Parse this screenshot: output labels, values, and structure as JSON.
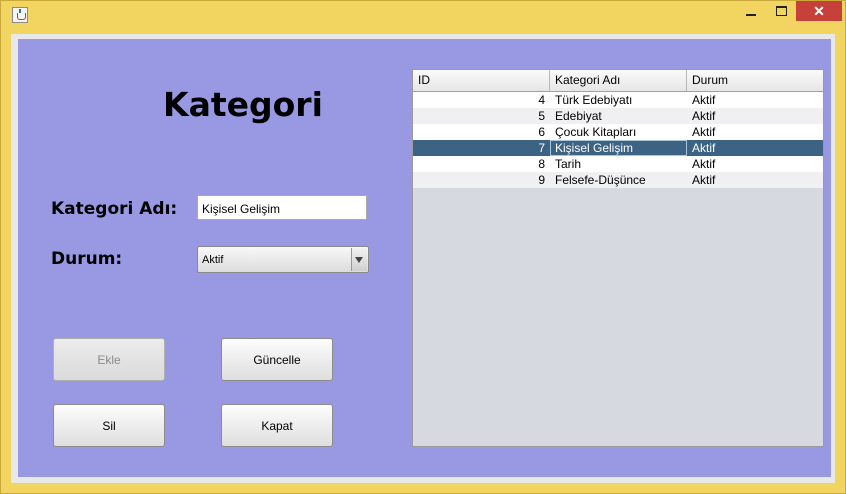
{
  "window": {
    "close_glyph": "✕"
  },
  "form": {
    "title": "Kategori",
    "kategori_adi_label": "Kategori Adı:",
    "kategori_adi_value": "Kişisel Gelişim",
    "durum_label": "Durum:",
    "durum_value": "Aktif"
  },
  "buttons": {
    "ekle": "Ekle",
    "guncelle": "Güncelle",
    "sil": "Sil",
    "kapat": "Kapat"
  },
  "table": {
    "columns": [
      "ID",
      "Kategori Adı",
      "Durum"
    ],
    "rows": [
      {
        "id": "4",
        "ad": "Türk Edebiyatı",
        "durum": "Aktif"
      },
      {
        "id": "5",
        "ad": "Edebiyat",
        "durum": "Aktif"
      },
      {
        "id": "6",
        "ad": "Çocuk Kitapları",
        "durum": "Aktif"
      },
      {
        "id": "7",
        "ad": "Kişisel Gelişim",
        "durum": "Aktif"
      },
      {
        "id": "8",
        "ad": "Tarih",
        "durum": "Aktif"
      },
      {
        "id": "9",
        "ad": "Felsefe-Düşünce",
        "durum": "Aktif"
      }
    ],
    "selected_row_index": 3
  },
  "colors": {
    "panel_bg": "#9999e3",
    "window_frame": "#f2d561",
    "selected_row": "#3c6284",
    "close_button": "#c7403a"
  },
  "state": {
    "ekle_enabled": false
  }
}
